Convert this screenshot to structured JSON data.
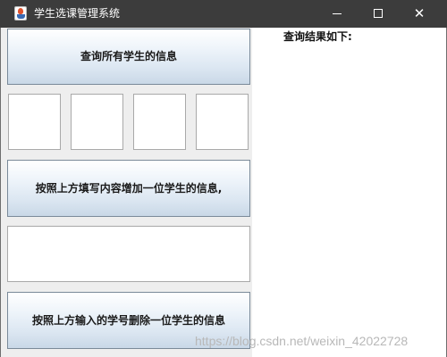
{
  "window": {
    "title": "学生选课管理系统",
    "app_icon": "java-cup-icon"
  },
  "controls": {
    "minimize_icon": "minimize-icon",
    "maximize_icon": "maximize-icon",
    "close_icon": "close-icon",
    "close_glyph": "✕"
  },
  "left_panel": {
    "query_button_label": "查询所有学生的信息",
    "input_fields": [
      "",
      "",
      "",
      ""
    ],
    "add_button_label": "按照上方填写内容增加一位学生的信息,",
    "student_id_field": "",
    "delete_button_label": "按照上方输入的学号删除一位学生的信息"
  },
  "right_panel": {
    "result_label": "查询结果如下:"
  },
  "watermark": "https://blog.csdn.net/weixin_42022728"
}
